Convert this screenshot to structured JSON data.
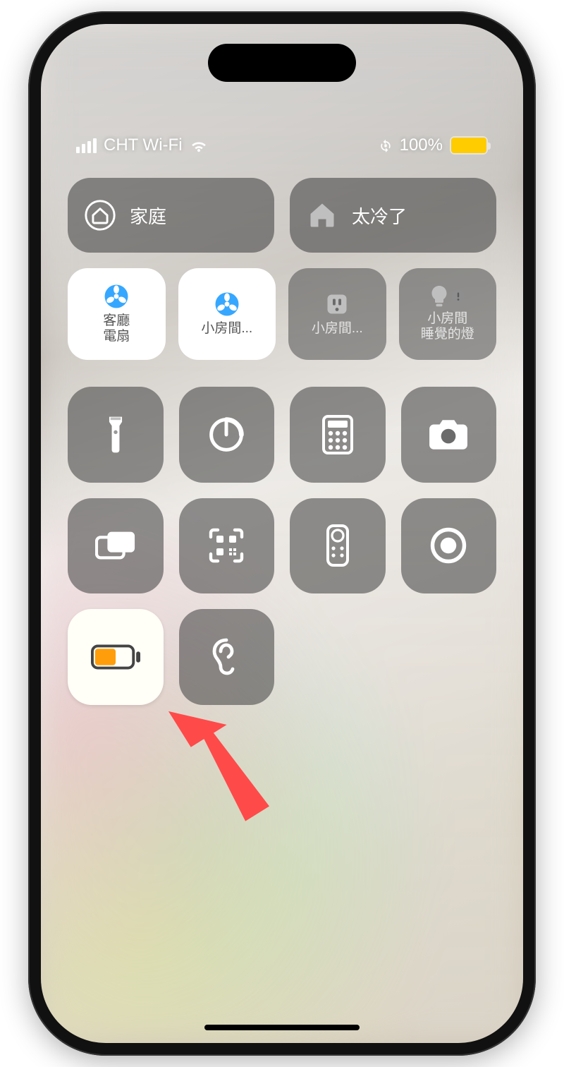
{
  "status": {
    "carrier": "CHT Wi-Fi",
    "battery_percent": "100%",
    "battery_color": "#ffcc00"
  },
  "home_row": {
    "home_label": "家庭",
    "scene_label": "太冷了"
  },
  "home_tiles": [
    {
      "label": "客廳\n電扇"
    },
    {
      "label": "小房間..."
    },
    {
      "label": "小房間..."
    },
    {
      "label": "小房間\n睡覺的燈"
    }
  ],
  "colors": {
    "tile_dark": "rgba(70,70,70,.58)",
    "tile_light": "#fffef7",
    "accent_blue": "#36a7ff",
    "battery_orange": "#ff9d0a"
  }
}
